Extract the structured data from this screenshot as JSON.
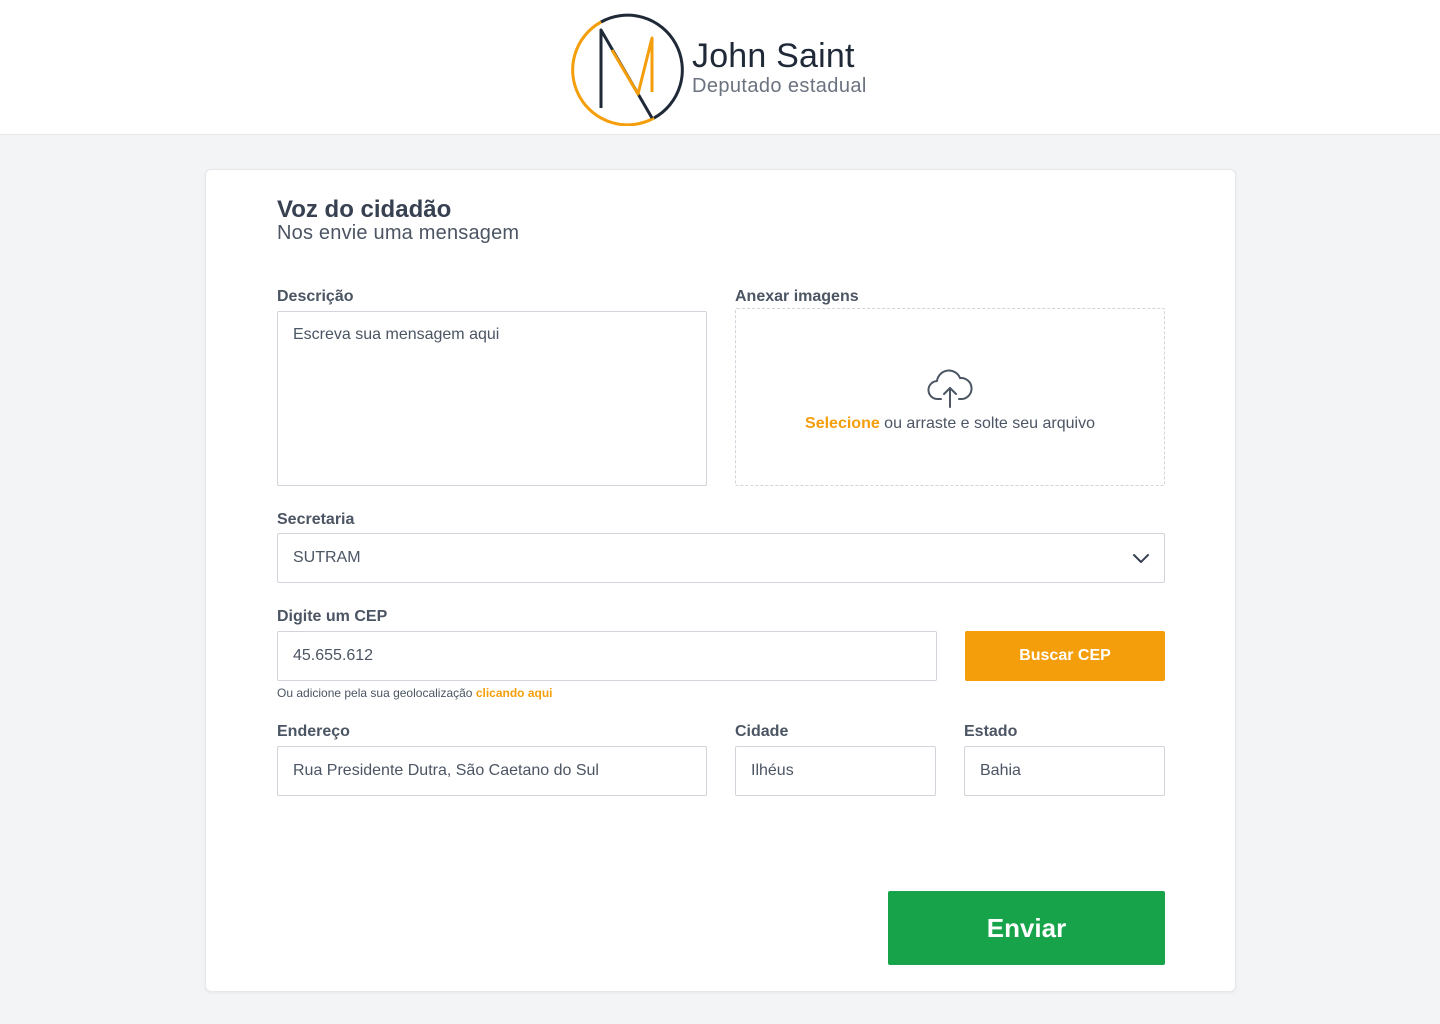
{
  "header": {
    "name": "John Saint",
    "role": "Deputado estadual",
    "colors": {
      "accent": "#f59e0b",
      "dark": "#1f2937"
    }
  },
  "form": {
    "title": "Voz do cidadão",
    "subtitle": "Nos envie uma mensagem",
    "description": {
      "label": "Descrição",
      "placeholder": "Escreva sua mensagem aqui"
    },
    "attachments": {
      "label": "Anexar imagens",
      "select_link": "Selecione",
      "drop_text": " ou arraste e solte seu arquivo",
      "icon": "cloud-upload-icon"
    },
    "secretaria": {
      "label": "Secretaria",
      "selected": "SUTRAM"
    },
    "cep": {
      "label": "Digite um CEP",
      "value": "45.655.612",
      "button": "Buscar CEP",
      "hint": "Ou adicione pela sua geolocalização ",
      "hint_link": "clicando aqui"
    },
    "address": {
      "label": "Endereço",
      "value": "Rua Presidente Dutra, São Caetano do Sul"
    },
    "city": {
      "label": "Cidade",
      "value": "Ilhéus"
    },
    "state": {
      "label": "Estado",
      "value": "Bahia"
    },
    "submit": "Enviar",
    "colors": {
      "primary_button": "#f59e0b",
      "submit_button": "#16a34a"
    }
  }
}
